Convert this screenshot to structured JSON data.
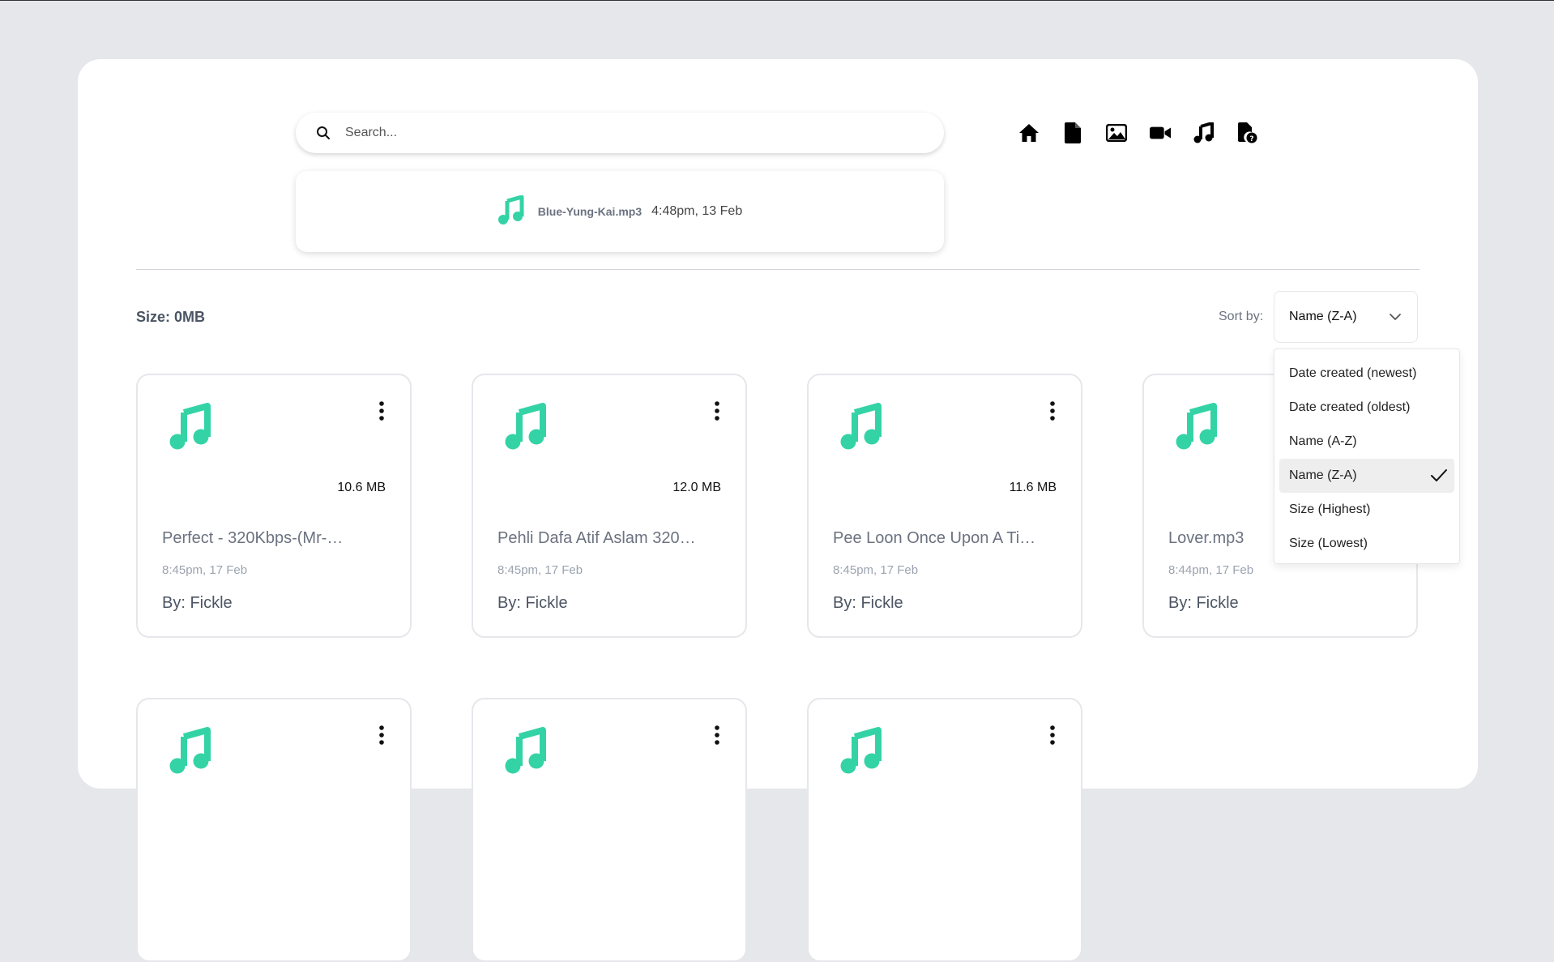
{
  "search": {
    "placeholder": "Search..."
  },
  "recent": {
    "filename": "Blue-Yung-Kai.mp3",
    "time": "4:48pm, 13 Feb"
  },
  "nav": [
    "home-icon",
    "document-icon",
    "image-icon",
    "video-icon",
    "music-icon",
    "unknown-file-icon"
  ],
  "size_label": "Size: 0MB",
  "sort": {
    "label": "Sort by:",
    "selected": "Name (Z-A)",
    "options": [
      "Date created (newest)",
      "Date created (oldest)",
      "Name (A-Z)",
      "Name (Z-A)",
      "Size (Highest)",
      "Size (Lowest)"
    ]
  },
  "cards": [
    {
      "size": "10.6 MB",
      "title": "Perfect - 320Kbps-(Mr-…",
      "date": "8:45pm, 17 Feb",
      "by": "By: Fickle"
    },
    {
      "size": "12.0 MB",
      "title": "Pehli Dafa Atif Aslam 320…",
      "date": "8:45pm, 17 Feb",
      "by": "By: Fickle"
    },
    {
      "size": "11.6 MB",
      "title": "Pee Loon Once Upon A Ti…",
      "date": "8:45pm, 17 Feb",
      "by": "By: Fickle"
    },
    {
      "size": "",
      "title": "Lover.mp3",
      "date": "8:44pm, 17 Feb",
      "by": "By: Fickle"
    }
  ],
  "colors": {
    "accent": "#34d3a6",
    "background": "#e5e7eb"
  }
}
